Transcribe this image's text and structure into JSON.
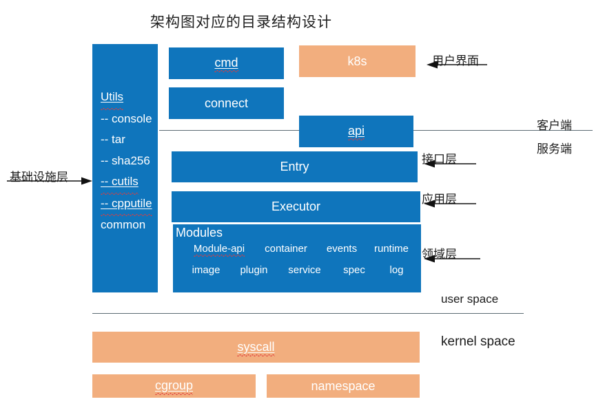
{
  "title": "架构图对应的目录结构设计",
  "colors": {
    "blue": "#0f75bc",
    "orange": "#f2ae7e",
    "divider": "#5b6a72",
    "text_light": "#ffffff",
    "text_dark": "#1a1a1a"
  },
  "utils_column": {
    "items": [
      "Utils",
      "-- console",
      "-- tar",
      "-- sha256",
      "-- cutils",
      "-- cpputile",
      "common"
    ]
  },
  "boxes": {
    "cmd": "cmd",
    "connect": "connect",
    "k8s": "k8s",
    "api": "api",
    "entry": "Entry",
    "executor": "Executor",
    "syscall": "syscall",
    "cgroup": "cgroup",
    "namespace": "namespace"
  },
  "modules": {
    "title": "Modules",
    "row1": [
      "Module-api",
      "container",
      "events",
      "runtime"
    ],
    "row2": [
      "image",
      "plugin",
      "service",
      "spec",
      "log"
    ]
  },
  "annotations": {
    "user_interface": "用户界面",
    "client": "客户端",
    "server": "服务端",
    "interface_layer": "接口层",
    "application_layer": "应用层",
    "domain_layer": "领域层",
    "infrastructure_layer": "基础设施层"
  },
  "space_labels": {
    "user_space": "user space",
    "kernel_space": "kernel space"
  }
}
